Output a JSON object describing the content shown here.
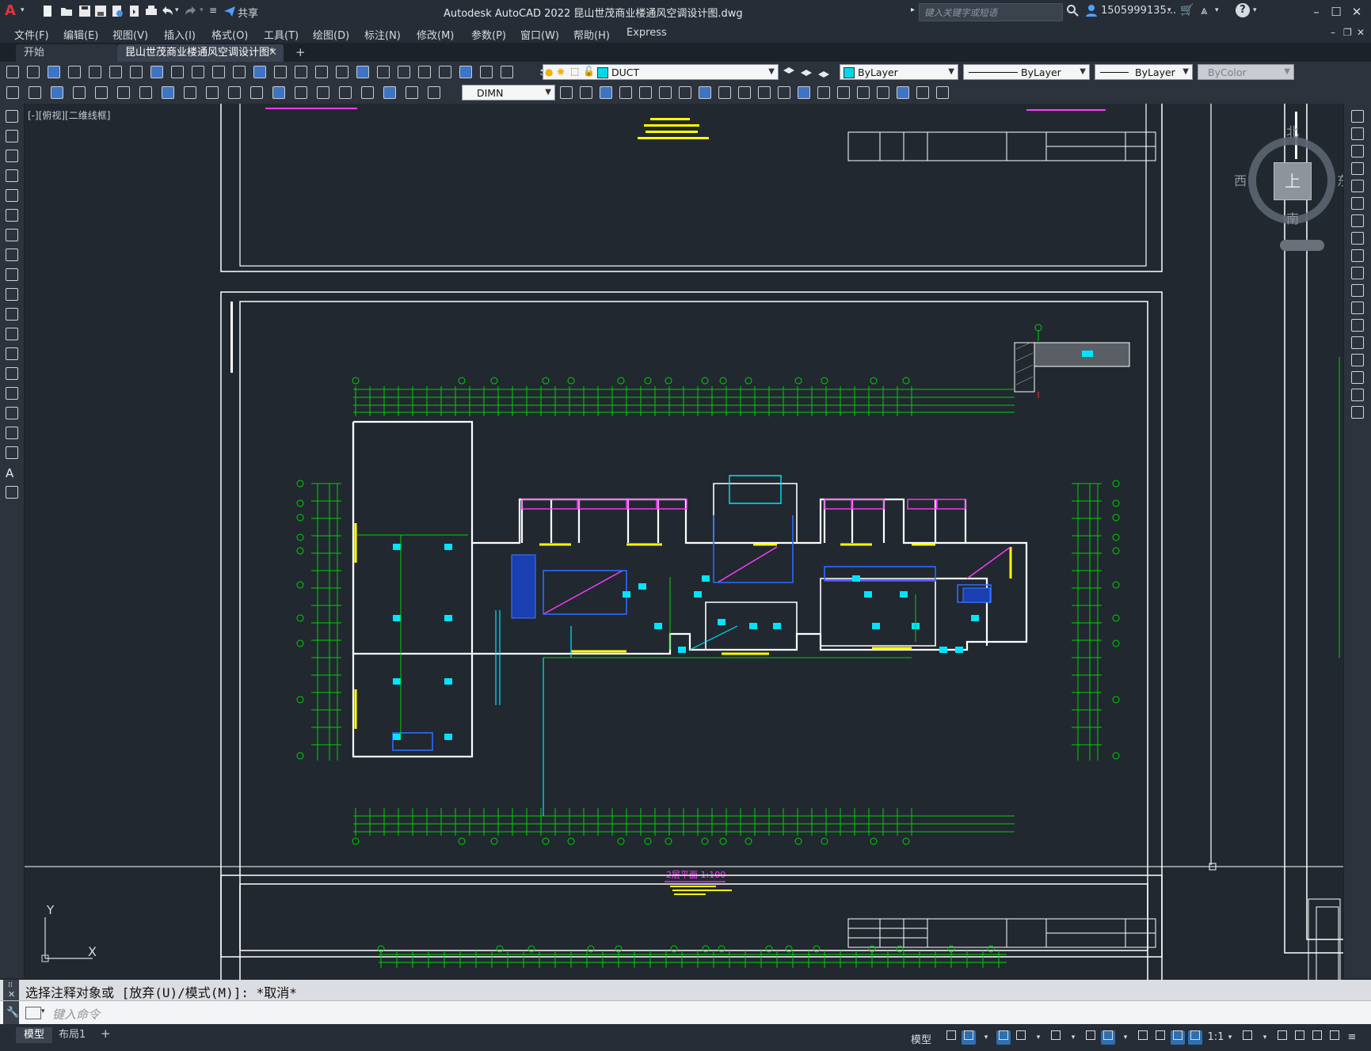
{
  "app": {
    "logo": "A",
    "title": "Autodesk AutoCAD 2022    昆山世茂商业楼通风空调设计图.dwg",
    "share_label": "共享",
    "search_placeholder": "键入关键字或短语",
    "user": "1505999135...",
    "window_controls": [
      "minimize-icon",
      "maximize-icon",
      "close-icon"
    ]
  },
  "menu": [
    "文件(F)",
    "编辑(E)",
    "视图(V)",
    "插入(I)",
    "格式(O)",
    "工具(T)",
    "绘图(D)",
    "标注(N)",
    "修改(M)",
    "参数(P)",
    "窗口(W)",
    "帮助(H)",
    "Express"
  ],
  "tabs": [
    {
      "label": "开始",
      "active": false
    },
    {
      "label": "昆山世茂商业楼通风空调设计图*",
      "active": true
    }
  ],
  "toolbar": {
    "layer": "DUCT",
    "color": "ByLayer",
    "linetype": "ByLayer",
    "lineweight": "ByLayer",
    "plotstyle": "ByColor",
    "dimstyle": "DIMN"
  },
  "viewport": {
    "label": "[-][俯视][二维线框]",
    "viewcube": {
      "north": "北",
      "south": "南",
      "east": "东",
      "west": "西",
      "top": "上"
    }
  },
  "drawing": {
    "title": "2层平面  1:100",
    "layer_color": "#00d200",
    "wall_color": "#ffffff",
    "duct_color": "#00e5ff",
    "accent": "#ff3cff"
  },
  "ucs": {
    "x": "X",
    "y": "Y"
  },
  "command": {
    "history": "选择注释对象或 [放弃(U)/模式(M)]: *取消*",
    "placeholder": "键入命令"
  },
  "status": {
    "layout_tabs": [
      "模型",
      "布局1"
    ],
    "model_label": "模型",
    "scale": "1:1"
  }
}
